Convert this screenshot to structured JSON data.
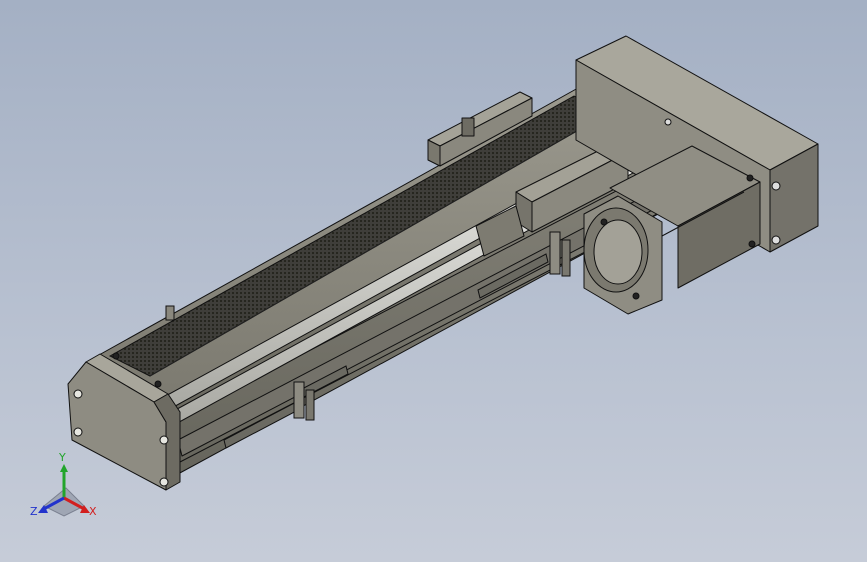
{
  "viewport": {
    "background_top": "#a4b0c4",
    "background_bottom": "#c6ccd8"
  },
  "model": {
    "name": "linear-actuator-with-stepper-motor",
    "body_color": "#8d8b80",
    "body_dark": "#5f5e55",
    "rail_color": "#d6d6d0",
    "edge_color": "#111111",
    "belt_cover_color": "#3a3a36",
    "parts": [
      "aluminum-profile-base",
      "belt-cover",
      "guide-rail",
      "carriage-slider",
      "limit-sensor",
      "end-plate",
      "motor-mount-housing",
      "stepper-motor"
    ]
  },
  "triad": {
    "x_label": "X",
    "y_label": "Y",
    "z_label": "Z",
    "x_color": "#d21f1f",
    "y_color": "#22a52b",
    "z_color": "#2233cc"
  }
}
